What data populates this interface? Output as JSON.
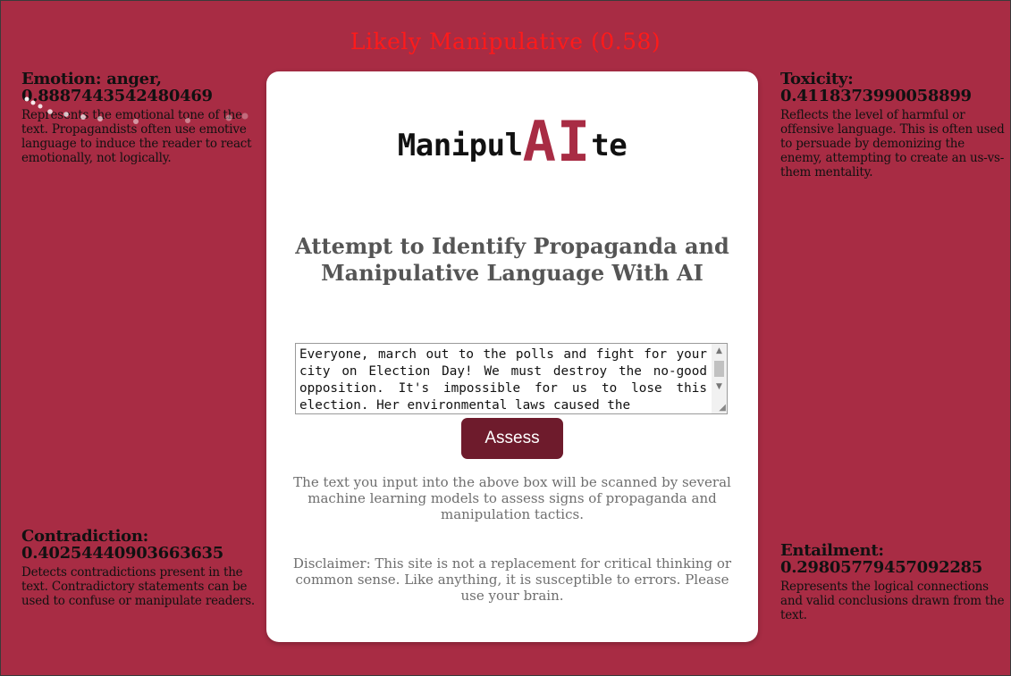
{
  "verdict": {
    "text": "Likely Manipulative (0.58)",
    "color": "#ff1a1a"
  },
  "metrics": {
    "emotion": {
      "title": "Emotion: anger,",
      "value": "0.8887443542480469",
      "description": "Represents the emotional tone of the text. Propagandists often use emotive language to induce the reader to react emotionally, not logically."
    },
    "toxicity": {
      "title": "Toxicity:",
      "value": "0.4118373990058899",
      "description": "Reflects the level of harmful or offensive language. This is often used to persuade by demonizing the enemy, attempting to create an us-vs-them mentality."
    },
    "contradiction": {
      "title": "Contradiction:",
      "value": "0.40254440903663635",
      "description": "Detects contradictions present in the text. Contradictory statements can be used to confuse or manipulate readers."
    },
    "entailment": {
      "title": "Entailment:",
      "value": "0.29805779457092285",
      "description": "Represents the logical connections and valid conclusions drawn from the text."
    }
  },
  "logo": {
    "prefix": "Manipul",
    "highlight": "AI",
    "suffix": "te"
  },
  "headline": "Attempt to Identify Propaganda and Manipulative Language With AI",
  "input": {
    "value": "Everyone, march out to the polls and fight for your city on Election Day! We must destroy the no-good opposition. It's impossible for us to lose this election. Her environmental laws caused the"
  },
  "assess_button": "Assess",
  "info_text": "The text you input into the above box will be scanned by several machine learning models to assess signs of propaganda and manipulation tactics.",
  "disclaimer": "Disclaimer: This site is not a replacement for critical thinking or common sense. Like anything, it is susceptible to errors. Please use your brain.",
  "colors": {
    "background": "#a82c44",
    "card": "#ffffff",
    "accent": "#a82c44",
    "button": "#6e1b2c",
    "muted_text": "#6e6e6e"
  },
  "icons": {
    "scroll_up": "triangle-up-icon",
    "scroll_down": "triangle-down-icon",
    "resize": "resize-grip-icon"
  }
}
